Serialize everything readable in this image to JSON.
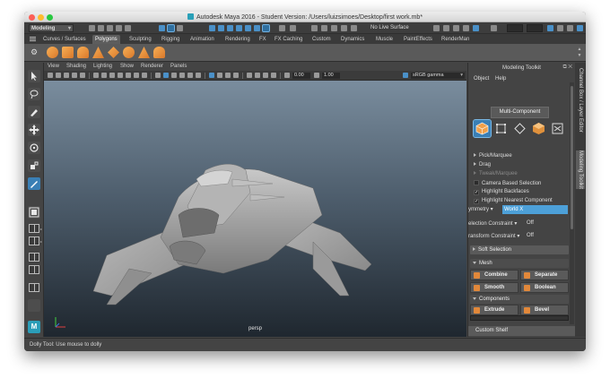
{
  "window": {
    "title": "Autodesk Maya 2016 - Student Version: /Users/luizsimoes/Desktop/first work.mb*"
  },
  "statusline": {
    "mode": "Modeling",
    "live_surface": "No Live Surface"
  },
  "shelf_tabs": [
    "Curves / Surfaces",
    "Polygons",
    "Sculpting",
    "Rigging",
    "Animation",
    "Rendering",
    "FX",
    "FX Caching",
    "Custom",
    "Dynamics",
    "Muscle",
    "PaintEffects",
    "RenderMan"
  ],
  "shelf_active": "Polygons",
  "panel_menu": [
    "View",
    "Shading",
    "Lighting",
    "Show",
    "Renderer",
    "Panels"
  ],
  "panel_toolbar": {
    "exposure": "0.00",
    "gamma": "1.00",
    "color_space": "sRGB gamma"
  },
  "viewport": {
    "camera_label": "persp"
  },
  "helpline": {
    "text": "Dolly Tool: Use mouse to dolly"
  },
  "toolkit": {
    "title": "Modeling Toolkit",
    "menu": [
      "Object",
      "Help"
    ],
    "mode": "Multi-Component",
    "options": {
      "pick_marquee": "Pick/Marquee",
      "drag": "Drag",
      "tweak_marquee": "Tweak/Marquee",
      "camera_based": "Camera Based Selection",
      "highlight_backfaces": "Highlight Backfaces",
      "highlight_nearest": "Highlight Nearest Component"
    },
    "symmetry_label": "ymmetry",
    "symmetry_value": "World X",
    "selection_constraint_label": "election Constraint",
    "selection_constraint_value": "Off",
    "transform_constraint_label": "ransform Constraint",
    "transform_constraint_value": "Off",
    "soft_selection": "Soft Selection",
    "mesh_section": "Mesh",
    "buttons_mesh": [
      "Combine",
      "Separate",
      "Smooth",
      "Boolean"
    ],
    "components_section": "Components",
    "buttons_components": [
      "Extrude",
      "Bevel"
    ],
    "custom_shelf": "Custom Shelf"
  },
  "vtabs": [
    "Channel Box / Layer Editor",
    "Modeling Toolkit"
  ],
  "colors": {
    "accent_blue": "#4da0d8",
    "maya_orange": "#e2883a",
    "viewport_top": "#7a8d9e",
    "viewport_bottom": "#1f272f"
  }
}
